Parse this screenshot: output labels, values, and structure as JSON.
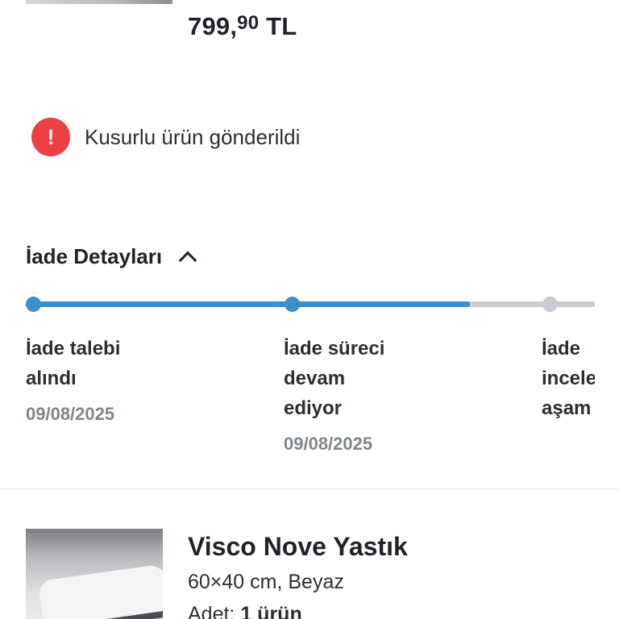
{
  "top_product": {
    "price_main": "799,",
    "price_decimal": "90",
    "price_currency": "TL"
  },
  "return_reason": {
    "icon": "alert-icon",
    "icon_glyph": "!",
    "text": "Kusurlu ürün gönderildi",
    "color": "#ec4044"
  },
  "return_details": {
    "title": "İade Detayları",
    "toggle_icon": "chevron-up-icon",
    "progress_color": "#3d8fc8",
    "inactive_color": "#c8cbcf",
    "steps": [
      {
        "label_lines": [
          "İade talebi",
          "alındı"
        ],
        "date": "09/08/2025",
        "state": "done"
      },
      {
        "label_lines": [
          "İade süreci",
          "devam",
          "ediyor"
        ],
        "date": "09/08/2025",
        "state": "done"
      },
      {
        "label_lines": [
          "İade",
          "incele",
          "aşam"
        ],
        "date": "",
        "state": "pending"
      }
    ]
  },
  "product": {
    "name": "Visco Nove Yastık",
    "variant": "60×40 cm, Beyaz",
    "qty_label": "Adet:",
    "qty_value": "1 ürün"
  }
}
